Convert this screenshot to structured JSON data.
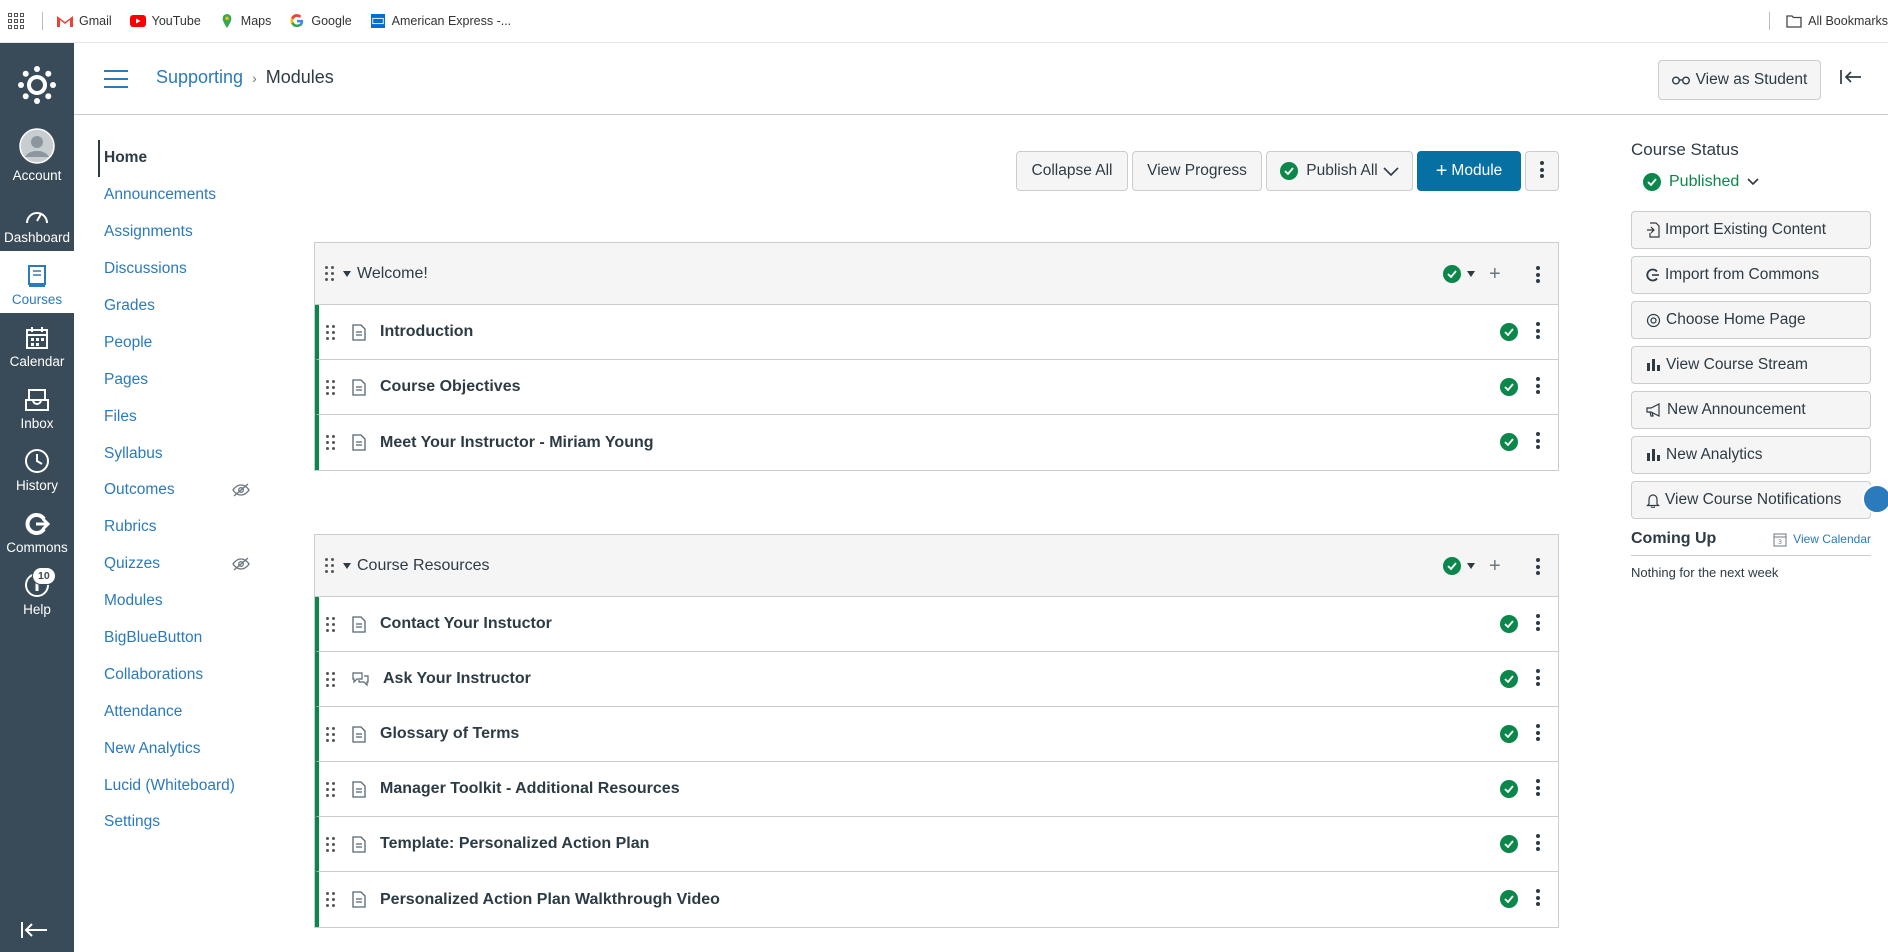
{
  "bookmarks": {
    "items": [
      {
        "label": "Gmail",
        "icon": "gmail-icon"
      },
      {
        "label": "YouTube",
        "icon": "youtube-icon"
      },
      {
        "label": "Maps",
        "icon": "maps-icon"
      },
      {
        "label": "Google",
        "icon": "google-icon"
      },
      {
        "label": "American Express -...",
        "icon": "amex-icon"
      }
    ],
    "all_bookmarks": "All Bookmarks"
  },
  "global_nav": {
    "items": [
      {
        "label": "Account",
        "icon": "avatar-icon"
      },
      {
        "label": "Dashboard",
        "icon": "dashboard-icon"
      },
      {
        "label": "Courses",
        "icon": "courses-icon"
      },
      {
        "label": "Calendar",
        "icon": "calendar-icon"
      },
      {
        "label": "Inbox",
        "icon": "inbox-icon"
      },
      {
        "label": "History",
        "icon": "history-icon"
      },
      {
        "label": "Commons",
        "icon": "commons-icon"
      },
      {
        "label": "Help",
        "icon": "help-icon",
        "badge": "10"
      }
    ],
    "active": "Courses"
  },
  "header": {
    "breadcrumb_course": "Supporting",
    "breadcrumb_page": "Modules",
    "view_as_student": "View as Student"
  },
  "course_nav": {
    "items": [
      {
        "label": "Home"
      },
      {
        "label": "Announcements"
      },
      {
        "label": "Assignments"
      },
      {
        "label": "Discussions"
      },
      {
        "label": "Grades"
      },
      {
        "label": "People"
      },
      {
        "label": "Pages"
      },
      {
        "label": "Files"
      },
      {
        "label": "Syllabus"
      },
      {
        "label": "Outcomes",
        "hidden": true
      },
      {
        "label": "Rubrics"
      },
      {
        "label": "Quizzes",
        "hidden": true
      },
      {
        "label": "Modules"
      },
      {
        "label": "BigBlueButton"
      },
      {
        "label": "Collaborations"
      },
      {
        "label": "Attendance"
      },
      {
        "label": "New Analytics"
      },
      {
        "label": "Lucid (Whiteboard)"
      },
      {
        "label": "Settings"
      }
    ],
    "active": "Home"
  },
  "toolbar": {
    "collapse_all": "Collapse All",
    "view_progress": "View Progress",
    "publish_all": "Publish All",
    "add_module": "Module"
  },
  "modules": [
    {
      "title": "Welcome!",
      "items": [
        {
          "title": "Introduction",
          "type": "page"
        },
        {
          "title": "Course Objectives",
          "type": "page"
        },
        {
          "title": "Meet Your Instructor - Miriam Young",
          "type": "page"
        }
      ]
    },
    {
      "title": "Course Resources",
      "items": [
        {
          "title": "Contact Your Instuctor",
          "type": "page"
        },
        {
          "title": "Ask Your Instructor",
          "type": "discussion"
        },
        {
          "title": "Glossary of Terms",
          "type": "page"
        },
        {
          "title": "Manager Toolkit - Additional Resources",
          "type": "page"
        },
        {
          "title": "Template: Personalized Action Plan",
          "type": "page"
        },
        {
          "title": "Personalized Action Plan Walkthrough Video",
          "type": "page"
        }
      ]
    }
  ],
  "sidebar": {
    "course_status": "Course Status",
    "published": "Published",
    "buttons": [
      {
        "label": "Import Existing Content",
        "icon": "import-icon"
      },
      {
        "label": "Import from Commons",
        "icon": "commons-icon"
      },
      {
        "label": "Choose Home Page",
        "icon": "target-icon"
      },
      {
        "label": "View Course Stream",
        "icon": "bar-chart-icon"
      },
      {
        "label": "New Announcement",
        "icon": "megaphone-icon"
      },
      {
        "label": "New Analytics",
        "icon": "bar-chart-icon"
      },
      {
        "label": "View Course Notifications",
        "icon": "bell-icon"
      }
    ],
    "coming_up": "Coming Up",
    "view_calendar": "View Calendar",
    "calendar_day": "3",
    "nothing_next_week": "Nothing for the next week"
  },
  "colors": {
    "nav_bg": "#394b58",
    "link": "#2b7abc",
    "published_green": "#0b874b",
    "primary_button": "#0770a3"
  }
}
